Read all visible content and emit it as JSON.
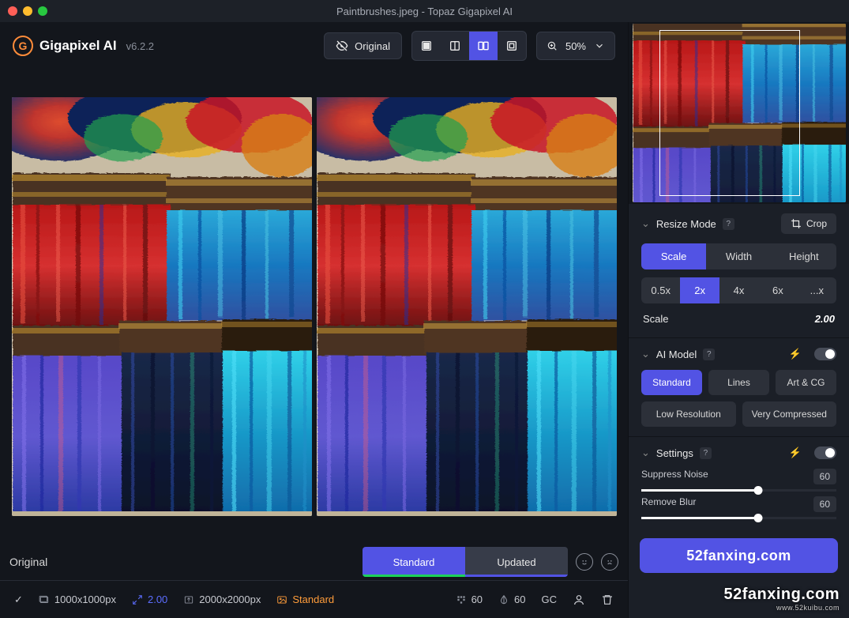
{
  "window": {
    "title": "Paintbrushes.jpeg - Topaz Gigapixel AI"
  },
  "header": {
    "brand": "Gigapixel AI",
    "version": "v6.2.2",
    "original_btn": "Original",
    "zoom_value": "50%"
  },
  "compare": {
    "original_label": "Original",
    "seg_a": "Standard",
    "seg_b": "Updated"
  },
  "status": {
    "check": "✓",
    "src_dim": "1000x1000px",
    "scale": "2.00",
    "out_dim": "2000x2000px",
    "model": "Standard",
    "noise": "60",
    "blur": "60",
    "gc": "GC"
  },
  "resize": {
    "title": "Resize Mode",
    "crop": "Crop",
    "modes": [
      "Scale",
      "Width",
      "Height"
    ],
    "mode_active": 0,
    "factors": [
      "0.5x",
      "2x",
      "4x",
      "6x",
      "...x"
    ],
    "factor_active": 1,
    "scale_label": "Scale",
    "scale_value": "2.00"
  },
  "aimodel": {
    "title": "AI Model",
    "row1": [
      "Standard",
      "Lines",
      "Art & CG"
    ],
    "row1_active": 0,
    "row2": [
      "Low Resolution",
      "Very Compressed"
    ]
  },
  "settings": {
    "title": "Settings",
    "suppress_label": "Suppress Noise",
    "suppress_value": "60",
    "blur_label": "Remove Blur",
    "blur_value": "60"
  },
  "action": {
    "text": "52fanxing.com",
    "sub": "www.52kuibu.com"
  }
}
